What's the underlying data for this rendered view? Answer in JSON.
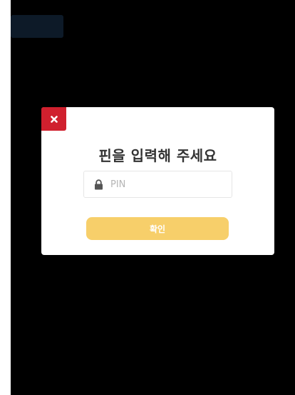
{
  "modal": {
    "title": "핀을 입력해 주세요",
    "pin_placeholder": "PIN",
    "pin_value": "",
    "confirm_label": "확인"
  },
  "icons": {
    "close": "close-icon",
    "lock": "lock-icon"
  },
  "colors": {
    "close_button": "#d0202e",
    "confirm_button": "#f7cf6a",
    "backdrop": "#000000"
  }
}
